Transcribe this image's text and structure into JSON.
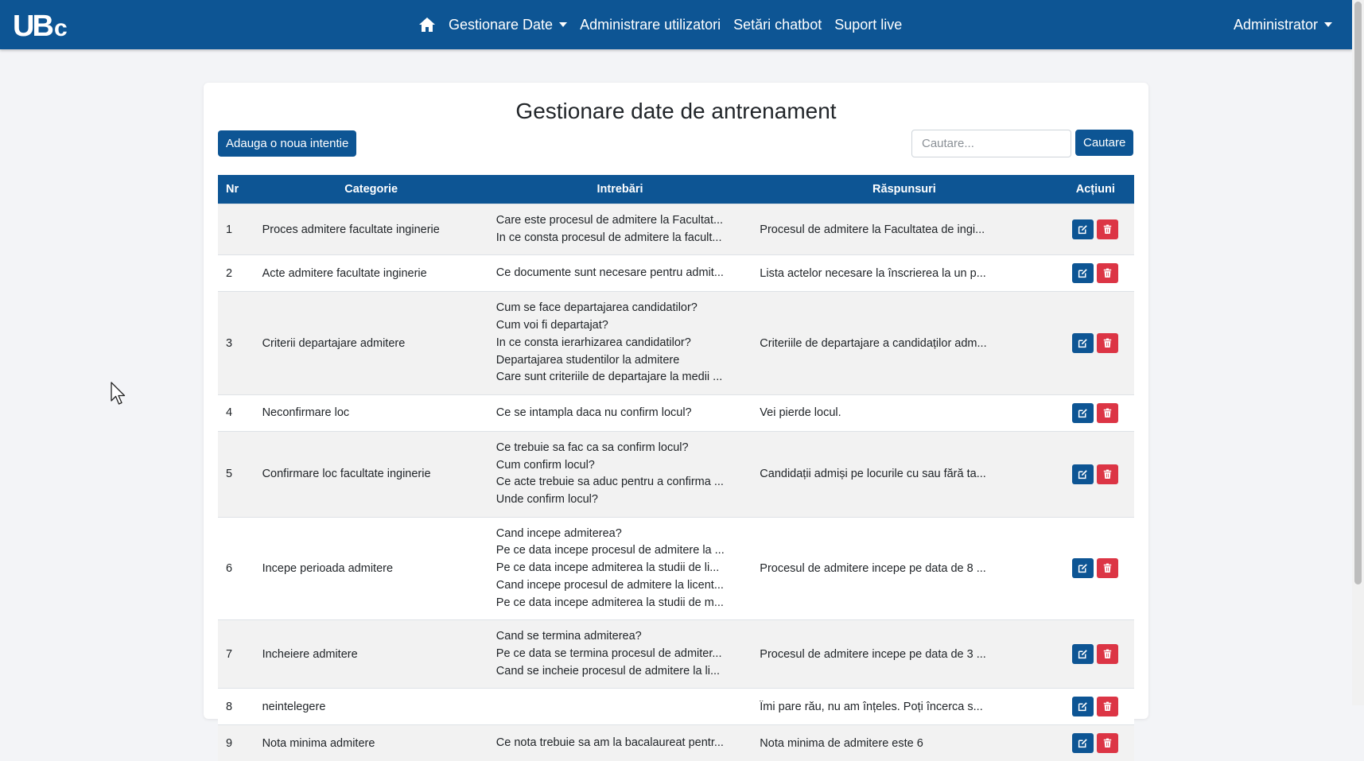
{
  "navbar": {
    "logo_text": "UBc",
    "menu": [
      {
        "label": "Gestionare Date",
        "dropdown": true
      },
      {
        "label": "Administrare utilizatori"
      },
      {
        "label": "Setări chatbot"
      },
      {
        "label": "Suport live"
      }
    ],
    "user_label": "Administrator",
    "color": "#0d5594"
  },
  "page": {
    "title": "Gestionare date de antrenament",
    "add_button": "Adauga o noua intentie",
    "search_placeholder": "Cautare...",
    "search_button": "Cautare"
  },
  "table": {
    "headers": {
      "nr": "Nr",
      "category": "Categorie",
      "questions": "Intrebări",
      "answers": "Răspunsuri",
      "actions": "Acțiuni"
    },
    "rows": [
      {
        "nr": "1",
        "category": "Proces admitere facultate inginerie",
        "questions": [
          "Care este procesul de admitere la Facultat...",
          "In ce consta procesul de admitere la facult..."
        ],
        "answer": "Procesul de admitere la Facultatea de ingi..."
      },
      {
        "nr": "2",
        "category": "Acte admitere facultate inginerie",
        "questions": [
          "Ce documente sunt necesare pentru admit..."
        ],
        "answer": "Lista actelor necesare la înscrierea la un p..."
      },
      {
        "nr": "3",
        "category": "Criterii departajare admitere",
        "questions": [
          "Cum se face departajarea candidatilor?",
          "Cum voi fi departajat?",
          "In ce consta ierarhizarea candidatilor?",
          "Departajarea studentilor la admitere",
          "Care sunt criteriile de departajare la medii ..."
        ],
        "answer": "Criteriile de departajare a candidaților adm..."
      },
      {
        "nr": "4",
        "category": "Neconfirmare loc",
        "questions": [
          "Ce se intampla daca nu confirm locul?"
        ],
        "answer": "Vei pierde locul."
      },
      {
        "nr": "5",
        "category": "Confirmare loc facultate inginerie",
        "questions": [
          "Ce trebuie sa fac ca sa confirm locul?",
          "Cum confirm locul?",
          "Ce acte trebuie sa aduc pentru a confirma ...",
          "Unde confirm locul?"
        ],
        "answer": "Candidații admiși pe locurile cu sau fără ta..."
      },
      {
        "nr": "6",
        "category": "Incepe perioada admitere",
        "questions": [
          "Cand incepe admiterea?",
          "Pe ce data incepe procesul de admitere la ...",
          "Pe ce data incepe admiterea la studii de li...",
          "Cand incepe procesul de admitere la licent...",
          "Pe ce data incepe admiterea la studii de m..."
        ],
        "answer": "Procesul de admitere incepe pe data de 8 ..."
      },
      {
        "nr": "7",
        "category": "Incheiere admitere",
        "questions": [
          "Cand se termina admiterea?",
          "Pe ce data se termina procesul de admiter...",
          "Cand se incheie procesul de admitere la li..."
        ],
        "answer": "Procesul de admitere incepe pe data de 3 ..."
      },
      {
        "nr": "8",
        "category": "neintelegere",
        "questions": [],
        "answer": "Îmi pare rău, nu am înțeles. Poți încerca s..."
      },
      {
        "nr": "9",
        "category": "Nota minima admitere",
        "questions": [
          "Ce nota trebuie sa am la bacalaureat pentr..."
        ],
        "answer": "Nota minima de admitere este 6"
      }
    ]
  },
  "colors": {
    "primary": "#0d5594",
    "danger": "#dc3545",
    "background": "#f3f4f7"
  }
}
